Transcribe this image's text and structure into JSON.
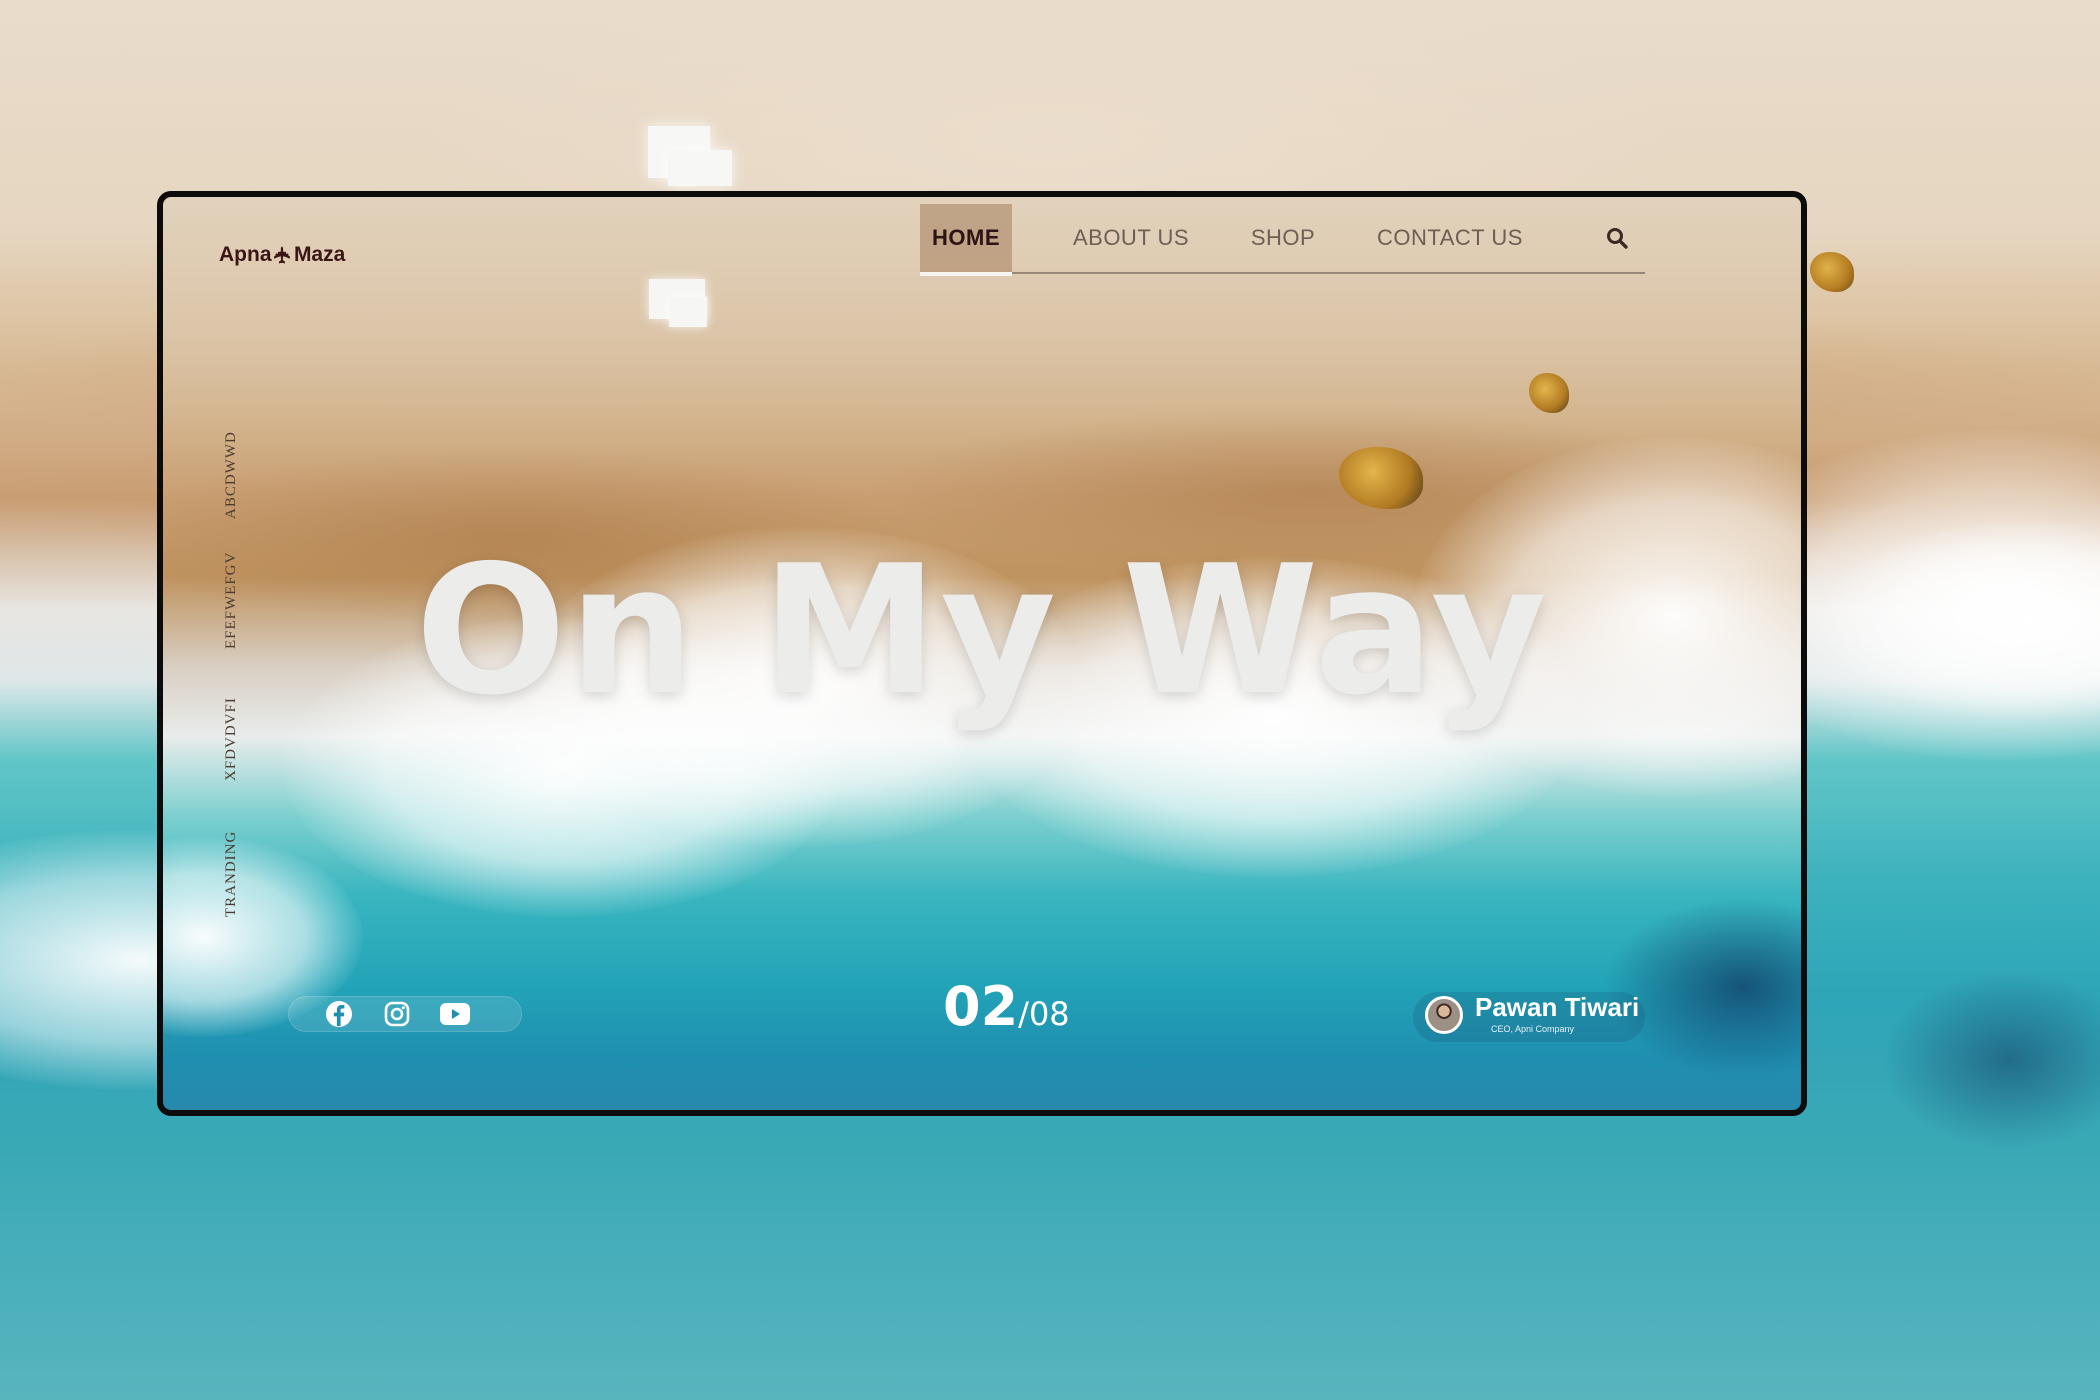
{
  "brand": {
    "name_left": "Apna",
    "name_right": "Maza",
    "icon": "airplane-icon"
  },
  "nav": {
    "items": [
      {
        "label": "HOME",
        "active": true
      },
      {
        "label": "ABOUT US",
        "active": false
      },
      {
        "label": "SHOP",
        "active": false
      },
      {
        "label": "CONTACT US",
        "active": false
      }
    ],
    "search_icon": "search-icon"
  },
  "side_labels": [
    "ABCDWWD",
    "EFEFWEFGV",
    "XFDVDVFI",
    "TRANDING"
  ],
  "hero": {
    "title": "On My Way"
  },
  "social": [
    "facebook-icon",
    "instagram-icon",
    "youtube-icon"
  ],
  "slide": {
    "current": "02",
    "separator": "/",
    "total": "08"
  },
  "profile": {
    "name": "Pawan Tiwari",
    "role": "CEO, Apni Company"
  },
  "colors": {
    "brand_text": "#3a1616",
    "nav_active_bg": "#a5805f",
    "hero_text": "#ececeb",
    "frame_border": "#0c0c0c"
  }
}
